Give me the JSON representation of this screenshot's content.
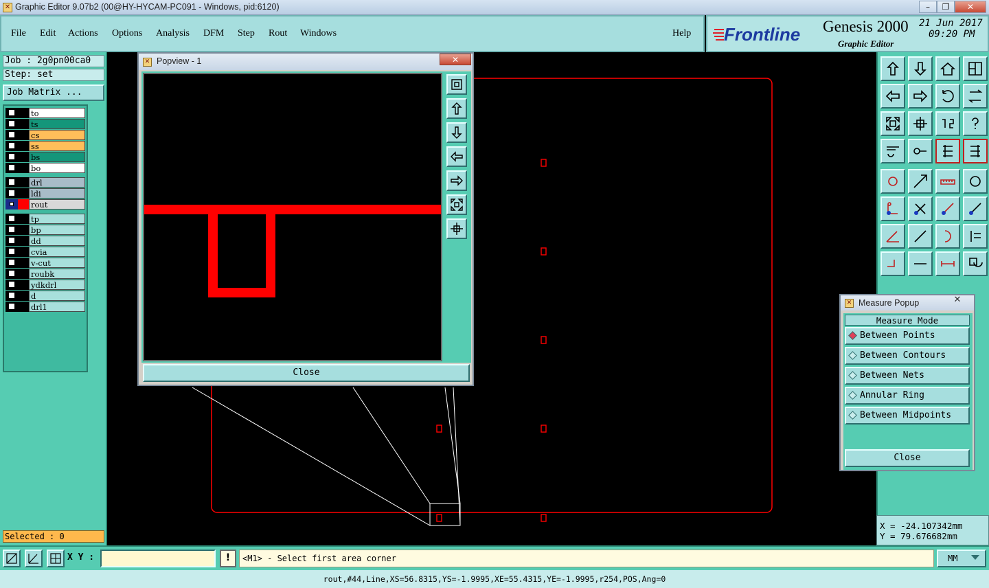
{
  "window": {
    "title": "Graphic Editor 9.07b2 (00@HY-HYCAM-PC091 - Windows, pid:6120)"
  },
  "menu": {
    "items": [
      "File",
      "Edit",
      "Actions",
      "Options",
      "Analysis",
      "DFM",
      "Step",
      "Rout",
      "Windows"
    ],
    "help": "Help"
  },
  "brand": {
    "logo": "Frontline",
    "product": "Genesis 2000",
    "subtitle": "Graphic Editor",
    "date": "21 Jun 2017",
    "time": "09:20 PM"
  },
  "left_panel": {
    "job": "Job : 2g0pn00ca0",
    "step": "Step: set",
    "job_matrix": "Job Matrix ...",
    "layers": [
      {
        "name": "to",
        "color": "#ffffff"
      },
      {
        "name": "ts",
        "color": "#14967a"
      },
      {
        "name": "cs",
        "color": "#ffbe5a"
      },
      {
        "name": "ss",
        "color": "#ffbe5a"
      },
      {
        "name": "bs",
        "color": "#14967a"
      },
      {
        "name": "bo",
        "color": "#ffffff"
      },
      {
        "name": "drl",
        "color": "#a8bcc8"
      },
      {
        "name": "ldi",
        "color": "#a8bcc8"
      },
      {
        "name": "rout",
        "color": "#d8d8d8",
        "active": true
      },
      {
        "name": "tp",
        "color": "#a8e0dc"
      },
      {
        "name": "bp",
        "color": "#a8e0dc"
      },
      {
        "name": "dd",
        "color": "#a8e0dc"
      },
      {
        "name": "cvia",
        "color": "#a8e0dc"
      },
      {
        "name": "v-cut",
        "color": "#a8e0dc"
      },
      {
        "name": "roubk",
        "color": "#a8e0dc"
      },
      {
        "name": "ydkdrl",
        "color": "#a8e0dc"
      },
      {
        "name": "d",
        "color": "#a8e0dc"
      },
      {
        "name": "drl1",
        "color": "#a8e0dc"
      }
    ],
    "selected": "Selected : 0"
  },
  "popview": {
    "title": "Popview - 1",
    "close": "Close",
    "side_icons": [
      "zoom-home-icon",
      "pan-up-icon",
      "pan-down-icon",
      "pan-left-icon",
      "pan-right-icon",
      "zoom-in-icon",
      "zoom-out-icon"
    ]
  },
  "measure_popup": {
    "title": "Measure Popup",
    "heading": "Measure Mode",
    "options": [
      "Between Points",
      "Between Contours",
      "Between Nets",
      "Annular Ring",
      "Between Midpoints"
    ],
    "selected_option": "Between Points",
    "close": "Close"
  },
  "coordinates": {
    "x": "X = -24.107342mm",
    "y": "Y = 79.676682mm"
  },
  "command_bar": {
    "xy_label": "X Y :",
    "xy_value": "",
    "prompt": "<M1> - Select first area corner",
    "units": "MM"
  },
  "status": "rout,#44,Line,XS=56.8315,YS=-1.9995,XE=55.4315,YE=-1.9995,r254,POS,Ang=0",
  "colors": {
    "accent_teal": "#56ccb2",
    "panel_light": "#a6dede",
    "rout_red": "#ff0000"
  }
}
